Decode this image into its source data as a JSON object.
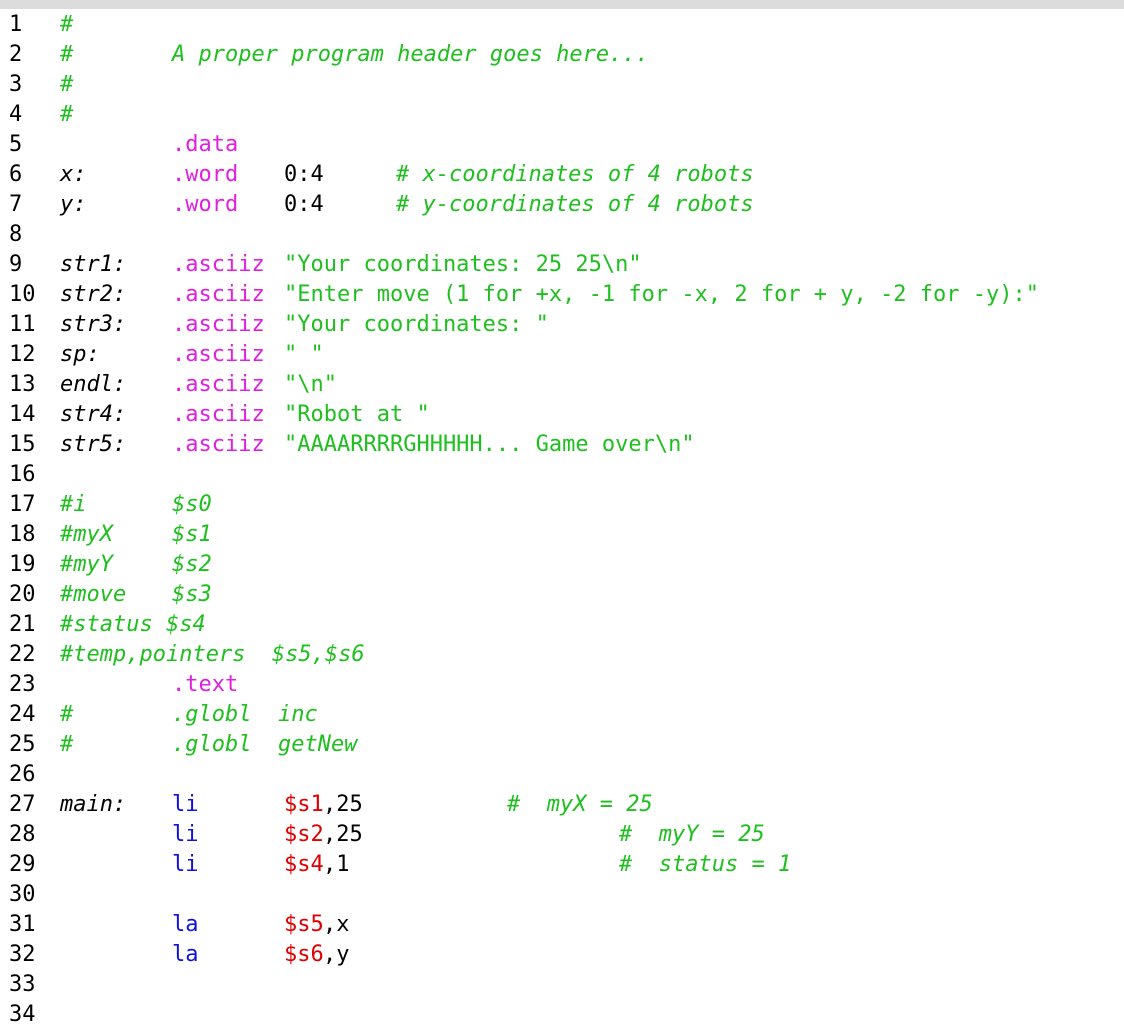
{
  "colors": {
    "comment": "#1fbf1f",
    "directive": "#e020e0",
    "string": "#1fbf1f",
    "opcode": "#1010e0",
    "register": "#e00000",
    "text": "#000000"
  },
  "lines": [
    {
      "n": "1",
      "tokens": [
        {
          "text": "#",
          "k": "hash",
          "c": 1
        }
      ]
    },
    {
      "n": "2",
      "tokens": [
        {
          "text": "#",
          "k": "hash",
          "c": 1
        },
        {
          "text": "A proper program header goes here...",
          "k": "comment",
          "c": 3
        }
      ]
    },
    {
      "n": "3",
      "tokens": [
        {
          "text": "#",
          "k": "hash",
          "c": 1
        }
      ]
    },
    {
      "n": "4",
      "tokens": [
        {
          "text": "#",
          "k": "hash",
          "c": 1
        }
      ]
    },
    {
      "n": "5",
      "tokens": [
        {
          "text": ".data",
          "k": "dir",
          "c": 3
        }
      ]
    },
    {
      "n": "6",
      "tokens": [
        {
          "text": "x:",
          "k": "label",
          "c": 1
        },
        {
          "text": ".word",
          "k": "dir",
          "c": 3
        },
        {
          "text": "0:4",
          "k": "plain",
          "c": 5
        },
        {
          "text": "# x-coordinates of 4 robots",
          "k": "comment",
          "c": 7
        }
      ]
    },
    {
      "n": "7",
      "tokens": [
        {
          "text": "y:",
          "k": "label",
          "c": 1
        },
        {
          "text": ".word",
          "k": "dir",
          "c": 3
        },
        {
          "text": "0:4",
          "k": "plain",
          "c": 5
        },
        {
          "text": "# y-coordinates of 4 robots",
          "k": "comment",
          "c": 7
        }
      ]
    },
    {
      "n": "8",
      "tokens": []
    },
    {
      "n": "9",
      "tokens": [
        {
          "text": "str1:",
          "k": "label",
          "c": 1
        },
        {
          "text": ".asciiz",
          "k": "dir",
          "c": 3
        },
        {
          "text": "\"Your coordinates: 25 25\\n\"",
          "k": "str",
          "c": 5
        }
      ]
    },
    {
      "n": "10",
      "tokens": [
        {
          "text": "str2:",
          "k": "label",
          "c": 1
        },
        {
          "text": ".asciiz",
          "k": "dir",
          "c": 3
        },
        {
          "text": "\"Enter move (1 for +x, -1 for -x, 2 for + y, -2 for -y):\"",
          "k": "str",
          "c": 5
        }
      ]
    },
    {
      "n": "11",
      "tokens": [
        {
          "text": "str3:",
          "k": "label",
          "c": 1
        },
        {
          "text": ".asciiz",
          "k": "dir",
          "c": 3
        },
        {
          "text": "\"Your coordinates: \"",
          "k": "str",
          "c": 5
        }
      ]
    },
    {
      "n": "12",
      "tokens": [
        {
          "text": "sp:",
          "k": "label",
          "c": 1
        },
        {
          "text": ".asciiz",
          "k": "dir",
          "c": 3
        },
        {
          "text": "\" \"",
          "k": "str",
          "c": 5
        }
      ]
    },
    {
      "n": "13",
      "tokens": [
        {
          "text": "endl:",
          "k": "label",
          "c": 1
        },
        {
          "text": ".asciiz",
          "k": "dir",
          "c": 3
        },
        {
          "text": "\"\\n\"",
          "k": "str",
          "c": 5
        }
      ]
    },
    {
      "n": "14",
      "tokens": [
        {
          "text": "str4:",
          "k": "label",
          "c": 1
        },
        {
          "text": ".asciiz",
          "k": "dir",
          "c": 3
        },
        {
          "text": "\"Robot at \"",
          "k": "str",
          "c": 5
        }
      ]
    },
    {
      "n": "15",
      "tokens": [
        {
          "text": "str5:",
          "k": "label",
          "c": 1
        },
        {
          "text": ".asciiz",
          "k": "dir",
          "c": 3
        },
        {
          "text": "\"AAAARRRRGHHHHH... Game over\\n\"",
          "k": "str",
          "c": 5
        }
      ]
    },
    {
      "n": "16",
      "tokens": []
    },
    {
      "n": "17",
      "tokens": [
        {
          "text": "#i",
          "k": "comment",
          "c": 1
        },
        {
          "text": "$s0",
          "k": "comment",
          "c": 3
        }
      ]
    },
    {
      "n": "18",
      "tokens": [
        {
          "text": "#myX",
          "k": "comment",
          "c": 1
        },
        {
          "text": "$s1",
          "k": "comment",
          "c": 3
        }
      ]
    },
    {
      "n": "19",
      "tokens": [
        {
          "text": "#myY",
          "k": "comment",
          "c": 1
        },
        {
          "text": "$s2",
          "k": "comment",
          "c": 3
        }
      ]
    },
    {
      "n": "20",
      "tokens": [
        {
          "text": "#move",
          "k": "comment",
          "c": 1
        },
        {
          "text": "$s3",
          "k": "comment",
          "c": 3
        }
      ]
    },
    {
      "n": "21",
      "tokens": [
        {
          "text": "#status $s4",
          "k": "comment",
          "c": 1
        }
      ]
    },
    {
      "n": "22",
      "tokens": [
        {
          "text": "#temp,pointers  $s5,$s6",
          "k": "comment",
          "c": 1
        }
      ]
    },
    {
      "n": "23",
      "tokens": [
        {
          "text": ".text",
          "k": "dir",
          "c": 3
        }
      ]
    },
    {
      "n": "24",
      "tokens": [
        {
          "text": "#",
          "k": "hash",
          "c": 1
        },
        {
          "text": ".globl  inc",
          "k": "comment",
          "c": 3
        }
      ]
    },
    {
      "n": "25",
      "tokens": [
        {
          "text": "#",
          "k": "hash",
          "c": 1
        },
        {
          "text": ".globl  getNew",
          "k": "comment",
          "c": 3
        }
      ]
    },
    {
      "n": "26",
      "tokens": []
    },
    {
      "n": "27",
      "tokens": [
        {
          "text": "main:",
          "k": "label",
          "c": 1
        },
        {
          "text": "li",
          "k": "op",
          "c": 3
        },
        {
          "text": "$s1",
          "k": "reg",
          "c": 5
        },
        {
          "text": ",25",
          "k": "plain",
          "c": 6
        },
        {
          "text": "#  myX = 25",
          "k": "comment",
          "c": 9
        }
      ]
    },
    {
      "n": "28",
      "tokens": [
        {
          "text": "li",
          "k": "op",
          "c": 3
        },
        {
          "text": "$s2",
          "k": "reg",
          "c": 5
        },
        {
          "text": ",25",
          "k": "plain",
          "c": 6
        },
        {
          "text": "#  myY = 25",
          "k": "comment",
          "c": 11
        }
      ]
    },
    {
      "n": "29",
      "tokens": [
        {
          "text": "li",
          "k": "op",
          "c": 3
        },
        {
          "text": "$s4",
          "k": "reg",
          "c": 5
        },
        {
          "text": ",1",
          "k": "plain",
          "c": 6
        },
        {
          "text": "#  status = 1",
          "k": "comment",
          "c": 11
        }
      ]
    },
    {
      "n": "30",
      "tokens": []
    },
    {
      "n": "31",
      "tokens": [
        {
          "text": "la",
          "k": "op",
          "c": 3
        },
        {
          "text": "$s5",
          "k": "reg",
          "c": 5
        },
        {
          "text": ",x",
          "k": "plain",
          "c": 6
        }
      ]
    },
    {
      "n": "32",
      "tokens": [
        {
          "text": "la",
          "k": "op",
          "c": 3
        },
        {
          "text": "$s6",
          "k": "reg",
          "c": 5
        },
        {
          "text": ",y",
          "k": "plain",
          "c": 6
        }
      ]
    },
    {
      "n": "33",
      "tokens": []
    },
    {
      "n": "34",
      "tokens": []
    }
  ]
}
